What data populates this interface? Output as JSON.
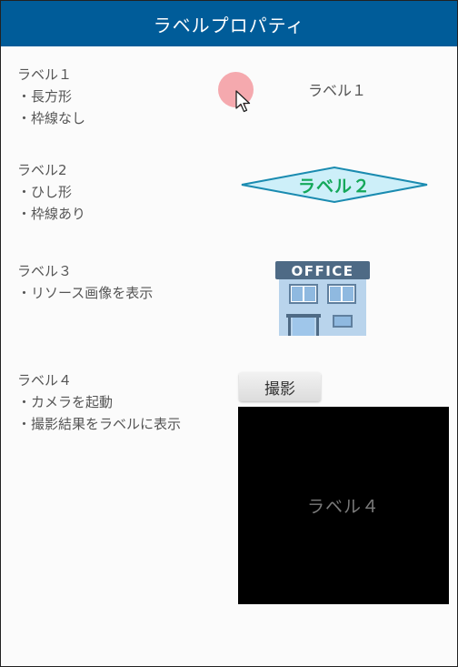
{
  "title": "ラベルプロパティ",
  "sections": [
    {
      "heading": "ラベル１",
      "lines": [
        "・長方形",
        "・枠線なし"
      ]
    },
    {
      "heading": "ラベル2",
      "lines": [
        "・ひし形",
        "・枠線あり"
      ]
    },
    {
      "heading": "ラベル３",
      "lines": [
        "・リソース画像を表示"
      ]
    },
    {
      "heading": "ラベル４",
      "lines": [
        "・カメラを起動",
        "・撮影結果をラベルに表示"
      ]
    }
  ],
  "label1": {
    "text": "ラベル１"
  },
  "label2": {
    "text": "ラベル２",
    "fill": "#cdeff9",
    "border": "#1a8bb0",
    "text_color": "#14a85a"
  },
  "label3": {
    "image_icon": "office-building-icon",
    "image_text": "OFFICE"
  },
  "label4": {
    "button_label": "撮影",
    "display_text": "ラベル４"
  },
  "colors": {
    "titlebar": "#005c99",
    "touch": "#f4a0a5"
  }
}
